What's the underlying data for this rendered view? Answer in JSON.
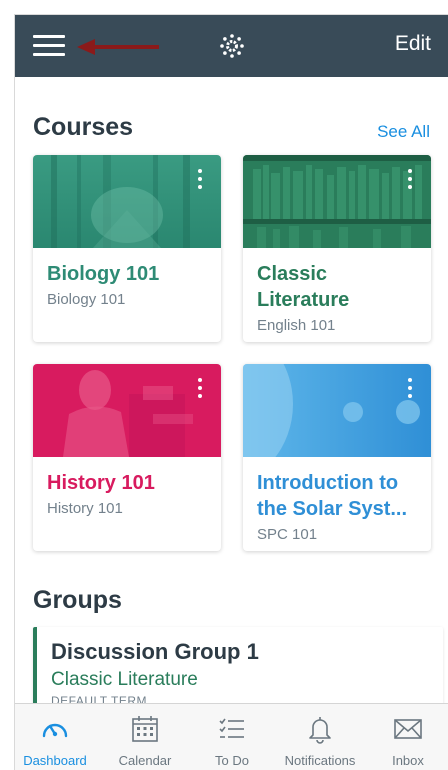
{
  "colors": {
    "topbar": "#394b58",
    "accent": "#1a8fe0",
    "arrow": "#8b1a1a",
    "biology": "#2e8b75",
    "classic": "#2a7d5b",
    "history": "#d81b5f",
    "solar": "#2f8fd6"
  },
  "header": {
    "menu_icon": "hamburger-icon",
    "logo_icon": "canvas-logo-icon",
    "edit_label": "Edit"
  },
  "courses": {
    "title": "Courses",
    "see_all": "See All",
    "items": [
      {
        "name": "Biology 101",
        "code": "Biology 101",
        "color": "#2e8b75"
      },
      {
        "name": "Classic Literature",
        "code": "English 101",
        "color": "#2a7d5b"
      },
      {
        "name": "History 101",
        "code": "History 101",
        "color": "#d81b5f"
      },
      {
        "name": "Introduction to the Solar Syst...",
        "code": "SPC 101",
        "color": "#2f8fd6"
      }
    ]
  },
  "groups": {
    "title": "Groups",
    "items": [
      {
        "name": "Discussion Group 1",
        "course": "Classic Literature",
        "term": "DEFAULT TERM"
      }
    ]
  },
  "tabs": [
    {
      "label": "Dashboard",
      "icon": "dashboard-icon",
      "active": true
    },
    {
      "label": "Calendar",
      "icon": "calendar-icon",
      "active": false
    },
    {
      "label": "To Do",
      "icon": "todo-list-icon",
      "active": false
    },
    {
      "label": "Notifications",
      "icon": "bell-icon",
      "active": false
    },
    {
      "label": "Inbox",
      "icon": "envelope-icon",
      "active": false
    }
  ]
}
